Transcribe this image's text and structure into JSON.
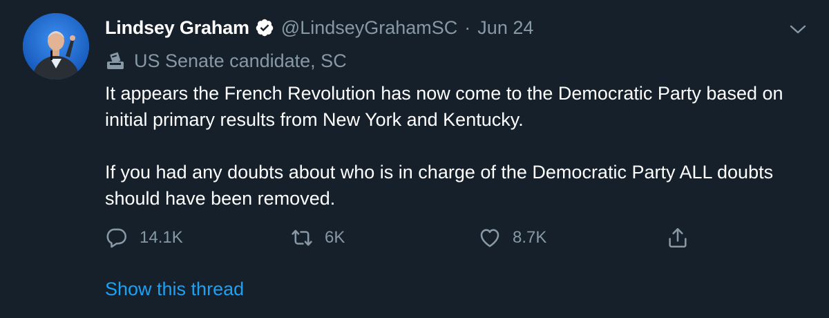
{
  "author": {
    "display_name": "Lindsey Graham",
    "handle": "@LindseyGrahamSC",
    "separator": "·",
    "date": "Jun 24",
    "verified": true,
    "label": "US Senate candidate, SC",
    "label_icon": "ballot-box-icon"
  },
  "tweet": {
    "paragraphs": [
      "It appears the French Revolution has now come to the Democratic Party based on initial primary results from New York and Kentucky.",
      "If you had any doubts about who is in charge of the Democratic Party ALL doubts should have been removed."
    ]
  },
  "actions": {
    "reply_count": "14.1K",
    "retweet_count": "6K",
    "like_count": "8.7K"
  },
  "show_thread": "Show this thread",
  "colors": {
    "background": "#15202b",
    "text_primary": "#ffffff",
    "text_secondary": "#8899a6",
    "link": "#1da1f2"
  }
}
